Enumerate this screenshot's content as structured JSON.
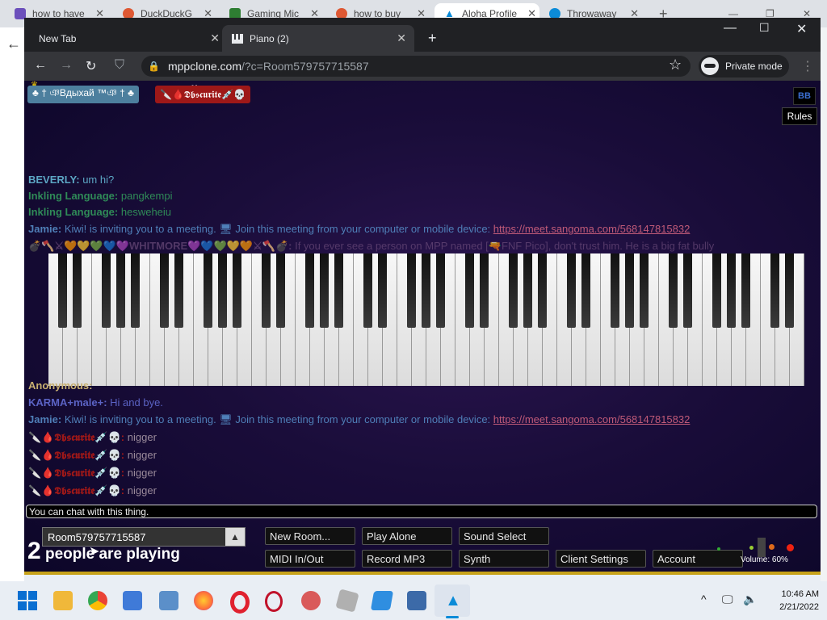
{
  "outer_tabs": [
    {
      "title": "how to have",
      "color": "#6b4fbb"
    },
    {
      "title": "DuckDuckG",
      "color": "#de5833"
    },
    {
      "title": "Gaming Mic",
      "color": "#2e7d32"
    },
    {
      "title": "how to buy",
      "color": "#de5833"
    },
    {
      "title": "Aloha Profile",
      "color": "#0b8bd8"
    },
    {
      "title": "Throwaway",
      "color": "#0b8bd8"
    }
  ],
  "outer_new_tab": "+",
  "inner_tabs": [
    {
      "title": "New Tab"
    },
    {
      "title": "Piano (2)"
    }
  ],
  "inner_new_tab": "+",
  "address": {
    "host": "mppclone.com",
    "path": "/?c=Room579757715587"
  },
  "private_label": "Private mode",
  "user_labels": [
    {
      "text": "♣ † ঞBдыхай ™ঞ † ♣",
      "color": "#4d7f9e"
    },
    {
      "text": "🔪🩸𝕯𝖇𝖘𝖈𝖚𝖗𝖎𝖙𝖊💉💀",
      "color": "#9e1818"
    }
  ],
  "me_tag": "Me",
  "bb_label": "BB",
  "rules_label": "Rules",
  "chat_messages": [
    {
      "name": "BEVERLY:",
      "text": "um hi?",
      "name_color": "#5ca6c4",
      "text_color": "#5ca6c4"
    },
    {
      "name": "Inkling Language:",
      "text": "pangkempi",
      "name_color": "#2f8a57",
      "text_color": "#2f8a57"
    },
    {
      "name": "Inkling Language:",
      "text": "hesweheiu",
      "name_color": "#2f8a57",
      "text_color": "#2f8a57"
    },
    {
      "name": "Jamie:",
      "text": "Kiwi! is inviting you to a meeting. 🖥 Join this meeting from your computer or mobile device:",
      "link": "https://meet.sangoma.com/568147815832",
      "name_color": "#4f7fb8",
      "text_color": "#4f7fb8"
    },
    {
      "name": "💣🪓⚔🧡💛💚💙💜WHITMORE💜💙💚💛🧡⚔🪓💣:",
      "text": "If you ever see a person on MPP named [🔫FNF Pico], don't trust him. He is a big fat bully",
      "name_color": "#6b4b7a",
      "text_color": "#6b4b7a"
    },
    {
      "name": "Anonymous:",
      "text": "",
      "name_color": "#c8b070",
      "text_color": "#c8b070"
    },
    {
      "name": "KARMA+male+:",
      "text": "Hi and bye.",
      "name_color": "#5b63c4",
      "text_color": "#5b63c4"
    },
    {
      "name": "Jamie:",
      "text": "Kiwi! is inviting you to a meeting. 🖥 Join this meeting from your computer or mobile device:",
      "link": "https://meet.sangoma.com/568147815832",
      "name_color": "#4f7fb8",
      "text_color": "#4f7fb8"
    },
    {
      "name": "🔪🩸𝕯𝖇𝖘𝖈𝖚𝖗𝖎𝖙𝖊💉💀:",
      "text": "nigger",
      "name_color": "#9e1818",
      "text_color": "#9a8a9a"
    },
    {
      "name": "🔪🩸𝕯𝖇𝖘𝖈𝖚𝖗𝖎𝖙𝖊💉💀:",
      "text": "nigger",
      "name_color": "#9e1818",
      "text_color": "#9a8a9a"
    },
    {
      "name": "🔪🩸𝕯𝖇𝖘𝖈𝖚𝖗𝖎𝖙𝖊💉💀:",
      "text": "nigger",
      "name_color": "#9e1818",
      "text_color": "#9a8a9a"
    },
    {
      "name": "🔪🩸𝕯𝖇𝖘𝖈𝖚𝖗𝖎𝖙𝖊💉💀:",
      "text": "nigger",
      "name_color": "#9e1818",
      "text_color": "#9a8a9a"
    }
  ],
  "chat_input_placeholder": "You can chat with this thing.",
  "room_name": "Room579757715587",
  "people_count": "2",
  "people_label": "people are playing",
  "buttons_row1": [
    "New Room...",
    "Play Alone",
    "Sound Select"
  ],
  "buttons_row2": [
    "MIDI In/Out",
    "Record MP3",
    "Synth",
    "Client Settings",
    "Account"
  ],
  "volume_label": "Volume: 60%",
  "taskbar": {
    "icons": [
      {
        "name": "windows-start-icon",
        "color": "#0067c0"
      },
      {
        "name": "file-explorer-icon",
        "color": "#f0b83a"
      },
      {
        "name": "chrome-icon",
        "color": "#34a853"
      },
      {
        "name": "microsoft-store-icon",
        "color": "#3f7ad8"
      },
      {
        "name": "photos-icon",
        "color": "#5b8fc9"
      },
      {
        "name": "firefox-icon",
        "color": "#ff7139"
      },
      {
        "name": "opera-icon",
        "color": "#e0212f"
      },
      {
        "name": "opera-gx-icon",
        "color": "#c0122a"
      },
      {
        "name": "paint-icon",
        "color": "#d95a5a"
      },
      {
        "name": "roblox-icon",
        "color": "#b0b0b0"
      },
      {
        "name": "weather-icon",
        "color": "#2f8ee0"
      },
      {
        "name": "virtualbox-icon",
        "color": "#3c6aa8"
      },
      {
        "name": "aloha-icon",
        "color": "#0b8bd8"
      }
    ],
    "time": "10:46 AM",
    "date": "2/21/2022"
  }
}
